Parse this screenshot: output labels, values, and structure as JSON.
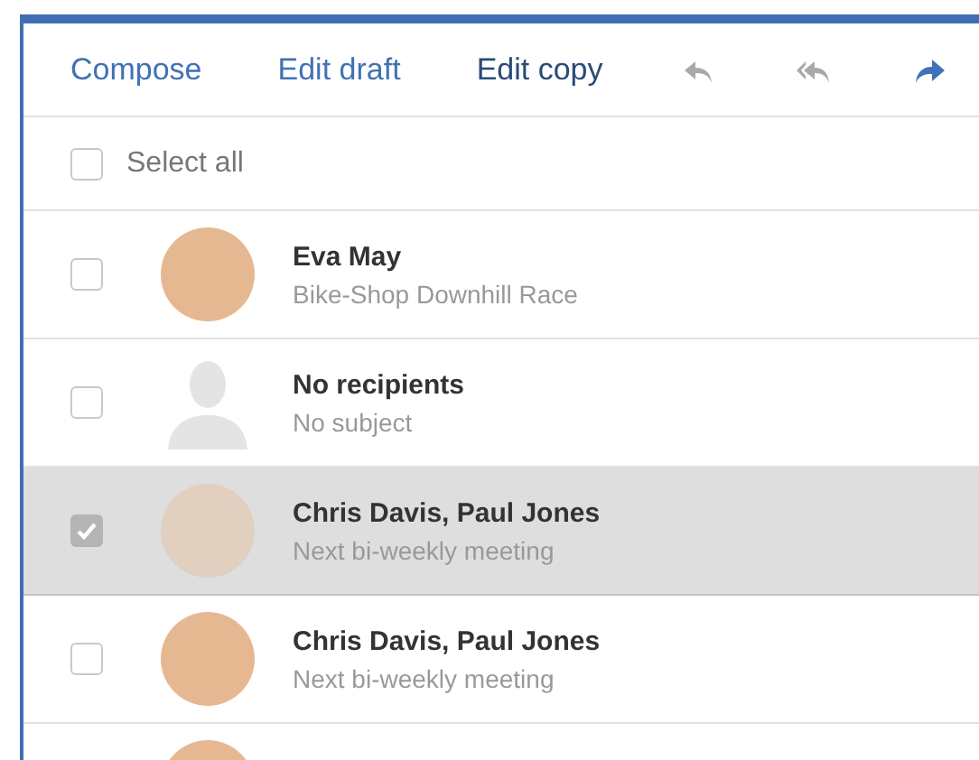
{
  "toolbar": {
    "actions": [
      {
        "label": "Compose",
        "selected": false
      },
      {
        "label": "Edit draft",
        "selected": false
      },
      {
        "label": "Edit copy",
        "selected": true
      }
    ],
    "icon_buttons": [
      {
        "kind": "reply",
        "disabled": true
      },
      {
        "kind": "reply-all",
        "disabled": true
      },
      {
        "kind": "forward",
        "disabled": false
      }
    ]
  },
  "select_all": {
    "label": "Select all",
    "checked": false
  },
  "messages": [
    {
      "sender": "Eva May",
      "subject": "Bike-Shop Downhill Race",
      "kind": "photo",
      "selected": false
    },
    {
      "sender": "No recipients",
      "subject": "No subject",
      "kind": "silhouette",
      "selected": false
    },
    {
      "sender": "Chris Davis, Paul Jones",
      "subject": "Next bi-weekly meeting",
      "kind": "photo",
      "selected": true
    },
    {
      "sender": "Chris Davis, Paul Jones",
      "subject": "Next bi-weekly meeting",
      "kind": "photo",
      "selected": false
    },
    {
      "kind": "photo",
      "selected": false
    }
  ]
}
